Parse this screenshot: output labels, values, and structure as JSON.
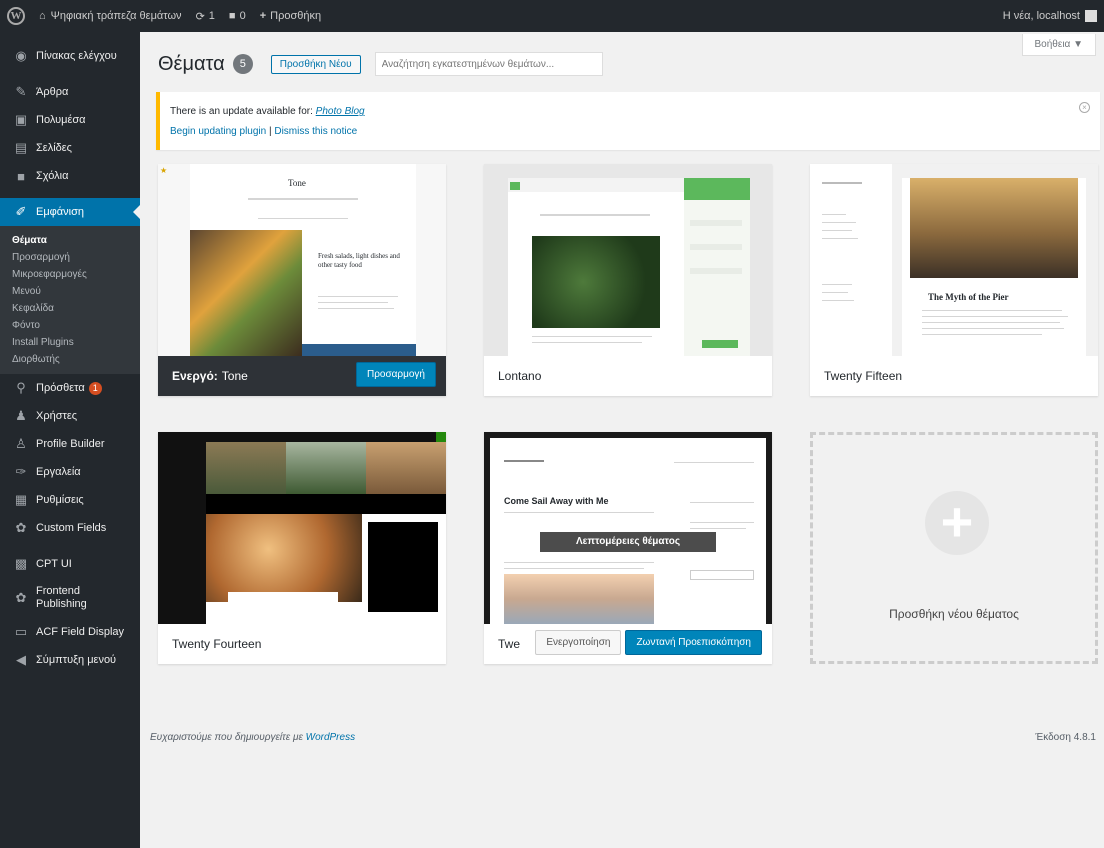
{
  "admin_bar": {
    "site_name": "Ψηφιακή τράπεζα θεμάτων",
    "updates_count": "1",
    "comments_count": "0",
    "new_label": "Προσθήκη",
    "greeting": "Η νέα, localhost"
  },
  "sidebar": {
    "dashboard": "Πίνακας ελέγχου",
    "posts": "Άρθρα",
    "media": "Πολυμέσα",
    "pages": "Σελίδες",
    "comments": "Σχόλια",
    "appearance": "Εμφάνιση",
    "appearance_sub": [
      "Θέματα",
      "Προσαρμογή",
      "Μικροεφαρμογές",
      "Μενού",
      "Κεφαλίδα",
      "Φόντο",
      "Install Plugins",
      "Διορθωτής"
    ],
    "plugins": "Πρόσθετα",
    "plugins_badge": "1",
    "users": "Χρήστες",
    "profile_builder": "Profile Builder",
    "tools": "Εργαλεία",
    "settings": "Ρυθμίσεις",
    "custom_fields": "Custom Fields",
    "cpt_ui": "CPT UI",
    "frontend_publishing": "Frontend Publishing",
    "acf_field_display": "ACF Field Display",
    "collapse_menu": "Σύμπτυξη μενού"
  },
  "header": {
    "help_label": "Βοήθεια ▼",
    "title": "Θέματα",
    "theme_count": "5",
    "add_new_label": "Προσθήκη Νέου",
    "search_placeholder": "Αναζήτηση εγκατεστημένων θεμάτων..."
  },
  "notice": {
    "text": "There is an update available for:",
    "plugin_link": "Photo Blog",
    "begin_link": "Begin updating plugin",
    "separator": " | ",
    "dismiss_link": "Dismiss this notice"
  },
  "themes": [
    {
      "name": "Tone",
      "active_prefix": "Ενεργό:",
      "customize_label": "Προσαρμογή",
      "preview_title": "Tone",
      "preview_heading": "Fresh salads, light dishes and other tasty food"
    },
    {
      "name": "Lontano"
    },
    {
      "name": "Twenty Fifteen",
      "preview_title": "The Myth of the Pier"
    },
    {
      "name": "Twenty Fourteen"
    },
    {
      "name": "Twenty Sixteen",
      "name_short": "Twe",
      "activate_label": "Ενεργοποίηση",
      "live_preview_label": "Ζωντανή Προεπισκόπηση",
      "details_label": "Λεπτομέρειες θέματος",
      "preview_title": "Come Sail Away with Me"
    }
  ],
  "add_new_theme": {
    "label": "Προσθήκη νέου θέματος"
  },
  "footer": {
    "thanks_text": "Ευχαριστούμε που δημιουργείτε με",
    "wordpress_link": "WordPress",
    "version": "Έκδοση 4.8.1"
  }
}
